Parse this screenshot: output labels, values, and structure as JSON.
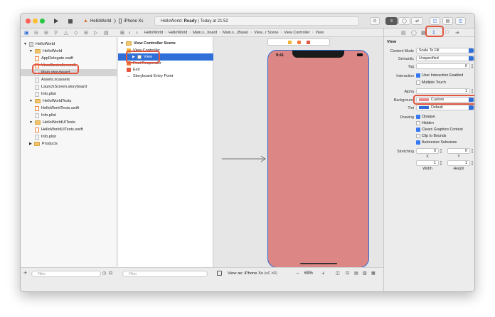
{
  "toolbar": {
    "run_icon": "play-icon",
    "stop_icon": "stop-icon",
    "scheme": "HelloWorld",
    "device": "iPhone Xs",
    "status_app": "HelloWorld:",
    "status_state": "Ready",
    "status_time": "| Today at 21:52"
  },
  "jumpbar": {
    "items": [
      "HelloWorld",
      "HelloWorld",
      "Main.s...board",
      "Main.s...(Base)",
      "View...r Scene",
      "View Controller",
      "View"
    ]
  },
  "navigator": {
    "items": [
      {
        "label": "HelloWorld",
        "kind": "project",
        "indent": 0
      },
      {
        "label": "HelloWorld",
        "kind": "folder",
        "indent": 1
      },
      {
        "label": "AppDelegate.swift",
        "kind": "swift",
        "indent": 2
      },
      {
        "label": "ViewController.swift",
        "kind": "swift",
        "indent": 2
      },
      {
        "label": "Main.storyboard",
        "kind": "storyboard",
        "indent": 2,
        "selected": true
      },
      {
        "label": "Assets.xcassets",
        "kind": "asset",
        "indent": 2
      },
      {
        "label": "LaunchScreen.storyboard",
        "kind": "storyboard",
        "indent": 2
      },
      {
        "label": "Info.plist",
        "kind": "plist",
        "indent": 2
      },
      {
        "label": "HelloWorldTests",
        "kind": "folder",
        "indent": 1
      },
      {
        "label": "HelloWorldTests.swift",
        "kind": "swift",
        "indent": 2
      },
      {
        "label": "Info.plist",
        "kind": "plist",
        "indent": 2
      },
      {
        "label": "HelloWorldUITests",
        "kind": "folder",
        "indent": 1
      },
      {
        "label": "HelloWorldUITests.swift",
        "kind": "swift",
        "indent": 2
      },
      {
        "label": "Info.plist",
        "kind": "plist",
        "indent": 2
      },
      {
        "label": "Products",
        "kind": "folder",
        "indent": 1
      }
    ],
    "filter_placeholder": "Filter"
  },
  "outline": {
    "scene": "View Controller Scene",
    "items": [
      {
        "label": "View Controller",
        "indent": 1
      },
      {
        "label": "View",
        "indent": 2,
        "selected": true
      },
      {
        "label": "First Responder",
        "indent": 1
      },
      {
        "label": "Exit",
        "indent": 1
      },
      {
        "label": "Storyboard Entry Point",
        "indent": 1
      }
    ],
    "filter_placeholder": "Filter"
  },
  "canvas": {
    "time": "9:41",
    "view_background": "#dd8686",
    "view_as_label": "View as:",
    "view_as_device": "iPhone Xs",
    "view_as_traits": "(wC hR)",
    "zoom": "69%"
  },
  "inspector": {
    "section": "View",
    "content_mode_label": "Content Mode",
    "content_mode": "Scale To Fill",
    "semantic_label": "Semantic",
    "semantic": "Unspecified",
    "tag_label": "Tag",
    "tag": "0",
    "interaction_label": "Interaction",
    "user_interaction": "User Interaction Enabled",
    "multiple_touch": "Multiple Touch",
    "alpha_label": "Alpha",
    "alpha": "1",
    "background_label": "Background",
    "background": "Custom",
    "background_color": "#e88a8a",
    "tint_label": "Tint",
    "tint": "Default",
    "tint_color": "#2f6fd7",
    "drawing_label": "Drawing",
    "opaque": "Opaque",
    "hidden": "Hidden",
    "clears_graphics": "Clears Graphics Context",
    "clip_to_bounds": "Clip to Bounds",
    "autoresize": "Autoresize Subviews",
    "stretching_label": "Stretching",
    "stretch_x": "0",
    "stretch_y": "0",
    "stretch_width": "1",
    "stretch_height": "1",
    "x_label": "X",
    "y_label": "Y",
    "width_label": "Width",
    "height_label": "Height"
  }
}
